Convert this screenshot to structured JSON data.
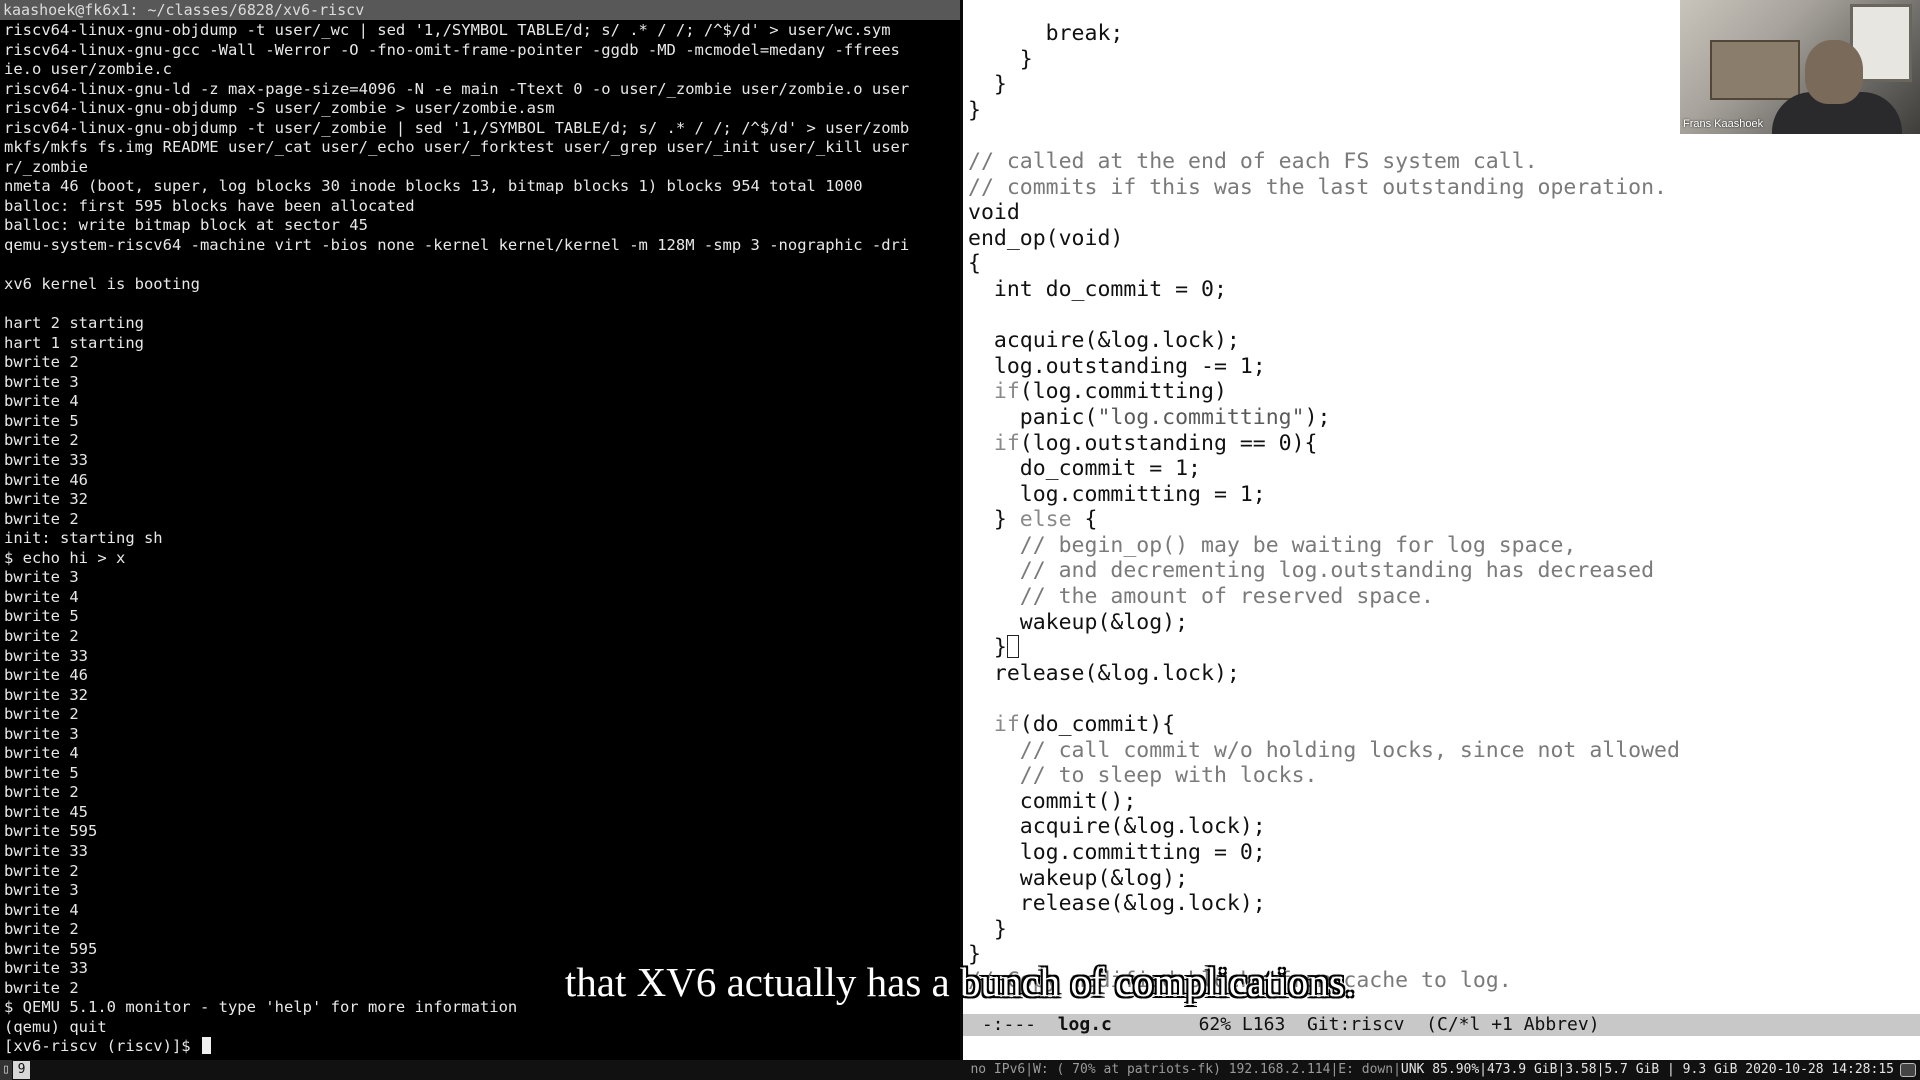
{
  "terminal": {
    "title": "kaashoek@fk6x1: ~/classes/6828/xv6-riscv",
    "lines": [
      "riscv64-linux-gnu-objdump -t user/_wc | sed '1,/SYMBOL TABLE/d; s/ .* / /; /^$/d' > user/wc.sym",
      "riscv64-linux-gnu-gcc -Wall -Werror -O -fno-omit-frame-pointer -ggdb -MD -mcmodel=medany -ffrees",
      "ie.o user/zombie.c",
      "riscv64-linux-gnu-ld -z max-page-size=4096 -N -e main -Ttext 0 -o user/_zombie user/zombie.o user",
      "riscv64-linux-gnu-objdump -S user/_zombie > user/zombie.asm",
      "riscv64-linux-gnu-objdump -t user/_zombie | sed '1,/SYMBOL TABLE/d; s/ .* / /; /^$/d' > user/zomb",
      "mkfs/mkfs fs.img README user/_cat user/_echo user/_forktest user/_grep user/_init user/_kill user",
      "r/_zombie",
      "nmeta 46 (boot, super, log blocks 30 inode blocks 13, bitmap blocks 1) blocks 954 total 1000",
      "balloc: first 595 blocks have been allocated",
      "balloc: write bitmap block at sector 45",
      "qemu-system-riscv64 -machine virt -bios none -kernel kernel/kernel -m 128M -smp 3 -nographic -dri",
      "",
      "xv6 kernel is booting",
      "",
      "hart 2 starting",
      "hart 1 starting",
      "bwrite 2",
      "bwrite 3",
      "bwrite 4",
      "bwrite 5",
      "bwrite 2",
      "bwrite 33",
      "bwrite 46",
      "bwrite 32",
      "bwrite 2",
      "init: starting sh",
      "$ echo hi > x",
      "bwrite 3",
      "bwrite 4",
      "bwrite 5",
      "bwrite 2",
      "bwrite 33",
      "bwrite 46",
      "bwrite 32",
      "bwrite 2",
      "bwrite 3",
      "bwrite 4",
      "bwrite 5",
      "bwrite 2",
      "bwrite 45",
      "bwrite 595",
      "bwrite 33",
      "bwrite 2",
      "bwrite 3",
      "bwrite 4",
      "bwrite 2",
      "bwrite 595",
      "bwrite 33",
      "bwrite 2",
      "$ QEMU 5.1.0 monitor - type 'help' for more information",
      "(qemu) quit"
    ],
    "prompt": "[xv6-riscv (riscv)]$ "
  },
  "editor": {
    "code_lines": [
      {
        "text": "      break;",
        "cls": ""
      },
      {
        "text": "    }",
        "cls": ""
      },
      {
        "text": "  }",
        "cls": ""
      },
      {
        "text": "}",
        "cls": ""
      },
      {
        "text": "",
        "cls": ""
      },
      {
        "text": "// called at the end of each FS system call.",
        "cls": "cmt"
      },
      {
        "text": "// commits if this was the last outstanding operation.",
        "cls": "cmt"
      },
      {
        "text": "void",
        "cls": ""
      },
      {
        "text": "end_op(void)",
        "cls": ""
      },
      {
        "text": "{",
        "cls": ""
      },
      {
        "text": "  int do_commit = 0;",
        "cls": ""
      },
      {
        "text": "",
        "cls": ""
      },
      {
        "text": "  acquire(&log.lock);",
        "cls": ""
      },
      {
        "text": "  log.outstanding -= 1;",
        "cls": ""
      },
      {
        "text": "  if(log.committing)",
        "cls": ""
      },
      {
        "text": "    panic(\"log.committing\");",
        "cls": ""
      },
      {
        "text": "  if(log.outstanding == 0){",
        "cls": ""
      },
      {
        "text": "    do_commit = 1;",
        "cls": ""
      },
      {
        "text": "    log.committing = 1;",
        "cls": ""
      },
      {
        "text": "  } else {",
        "cls": ""
      },
      {
        "text": "    // begin_op() may be waiting for log space,",
        "cls": "cmt"
      },
      {
        "text": "    // and decrementing log.outstanding has decreased",
        "cls": "cmt"
      },
      {
        "text": "    // the amount of reserved space.",
        "cls": "cmt"
      },
      {
        "text": "    wakeup(&log);",
        "cls": ""
      },
      {
        "text": "  }",
        "cls": "cursorline"
      },
      {
        "text": "  release(&log.lock);",
        "cls": ""
      },
      {
        "text": "",
        "cls": ""
      },
      {
        "text": "  if(do_commit){",
        "cls": ""
      },
      {
        "text": "    // call commit w/o holding locks, since not allowed",
        "cls": "cmt"
      },
      {
        "text": "    // to sleep with locks.",
        "cls": "cmt"
      },
      {
        "text": "    commit();",
        "cls": ""
      },
      {
        "text": "    acquire(&log.lock);",
        "cls": ""
      },
      {
        "text": "    log.committing = 0;",
        "cls": ""
      },
      {
        "text": "    wakeup(&log);",
        "cls": ""
      },
      {
        "text": "    release(&log.lock);",
        "cls": ""
      },
      {
        "text": "  }",
        "cls": ""
      },
      {
        "text": "}",
        "cls": ""
      },
      {
        "text": "// Copy modified blocks from cache to log.",
        "cls": "cmt"
      }
    ],
    "modeline": {
      "status": " -:---  ",
      "filename": "log.c",
      "position": "        62% L163",
      "vc": "  Git:riscv",
      "mode": "  (C/*l +1 Abbrev)"
    }
  },
  "webcam": {
    "name": "Frans Kaashoek"
  },
  "subtitle": "that XV6 actually has a bunch of complications.",
  "statusbar": {
    "workspace": "9",
    "left_info": "no IPv6|W: ( 70% at patriots-fk) 192.168.2.114|E: down|",
    "right_info": "UNK 85.90%|473.9 GiB|3.58|5.7 GiB | 9.3 GiB 2020-10-28 14:28:15"
  }
}
